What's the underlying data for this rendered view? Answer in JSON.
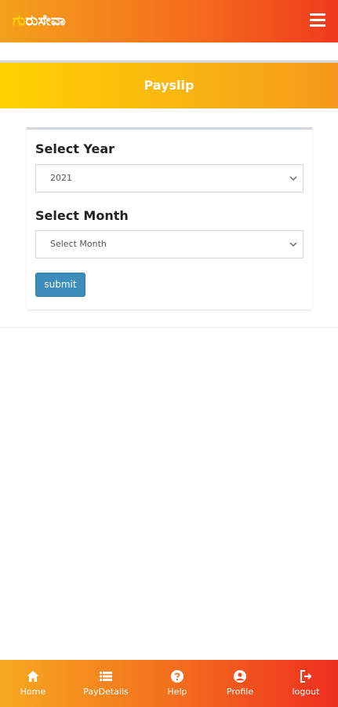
{
  "header": {
    "logo_first": "ಗು",
    "logo_rest": "ರುಸೇವಾ",
    "menu_icon": "hamburger-menu-icon"
  },
  "page": {
    "title": "Payslip"
  },
  "form": {
    "year_label": "Select Year",
    "year_value": "2021",
    "month_label": "Select Month",
    "month_value": "Select Month",
    "submit_label": "submit"
  },
  "bottom_nav": {
    "items": [
      {
        "label": "Home",
        "icon": "home-icon"
      },
      {
        "label": "PayDetails",
        "icon": "list-icon"
      },
      {
        "label": "Help",
        "icon": "help-icon"
      },
      {
        "label": "Profile",
        "icon": "user-icon"
      },
      {
        "label": "logout",
        "icon": "logout-icon"
      }
    ]
  },
  "colors": {
    "header_start": "#f4a11c",
    "header_end": "#ef3a1d",
    "banner_start": "#ffd200",
    "button": "#3c8dbc"
  }
}
